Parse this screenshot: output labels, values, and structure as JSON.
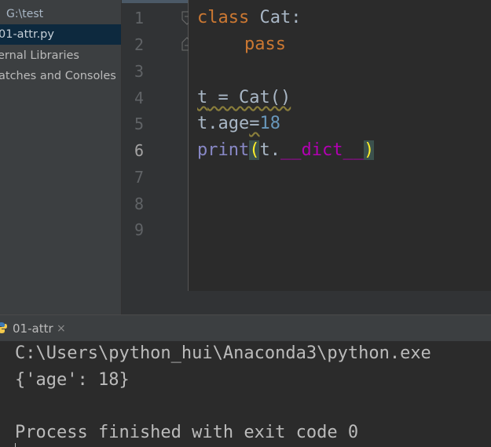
{
  "project_tree": {
    "root_prefix": ":",
    "root_path": "G:\\test",
    "file": "01-attr.py",
    "external": "ernal Libraries",
    "scratches": "atches and Consoles"
  },
  "editor": {
    "line_numbers": [
      "1",
      "2",
      "3",
      "4",
      "5",
      "6",
      "7",
      "8",
      "9"
    ],
    "current_line": "6",
    "code": {
      "l1_kw": "class",
      "l1_rest": " Cat:",
      "l2_kw": "pass",
      "l4_t": "t",
      "l4_rest": " = Cat()",
      "l5_a": "t.age",
      "l5_eq": "=",
      "l5_num": "18",
      "l6_print": "print",
      "l6_open": "(",
      "l6_t": "t.",
      "l6_dict": "__dict__",
      "l6_close": ")"
    }
  },
  "run_panel": {
    "tab_label": "01-attr",
    "tab_close": "×",
    "output": [
      "C:\\Users\\python_hui\\Anaconda3\\python.exe",
      "{'age': 18}",
      "",
      "Process finished with exit code 0"
    ]
  },
  "colors": {
    "keyword": "#cc7832",
    "number": "#6897bb",
    "builtin": "#8888c6",
    "magic": "#b200b2",
    "brace_highlight": "#ffef28"
  }
}
